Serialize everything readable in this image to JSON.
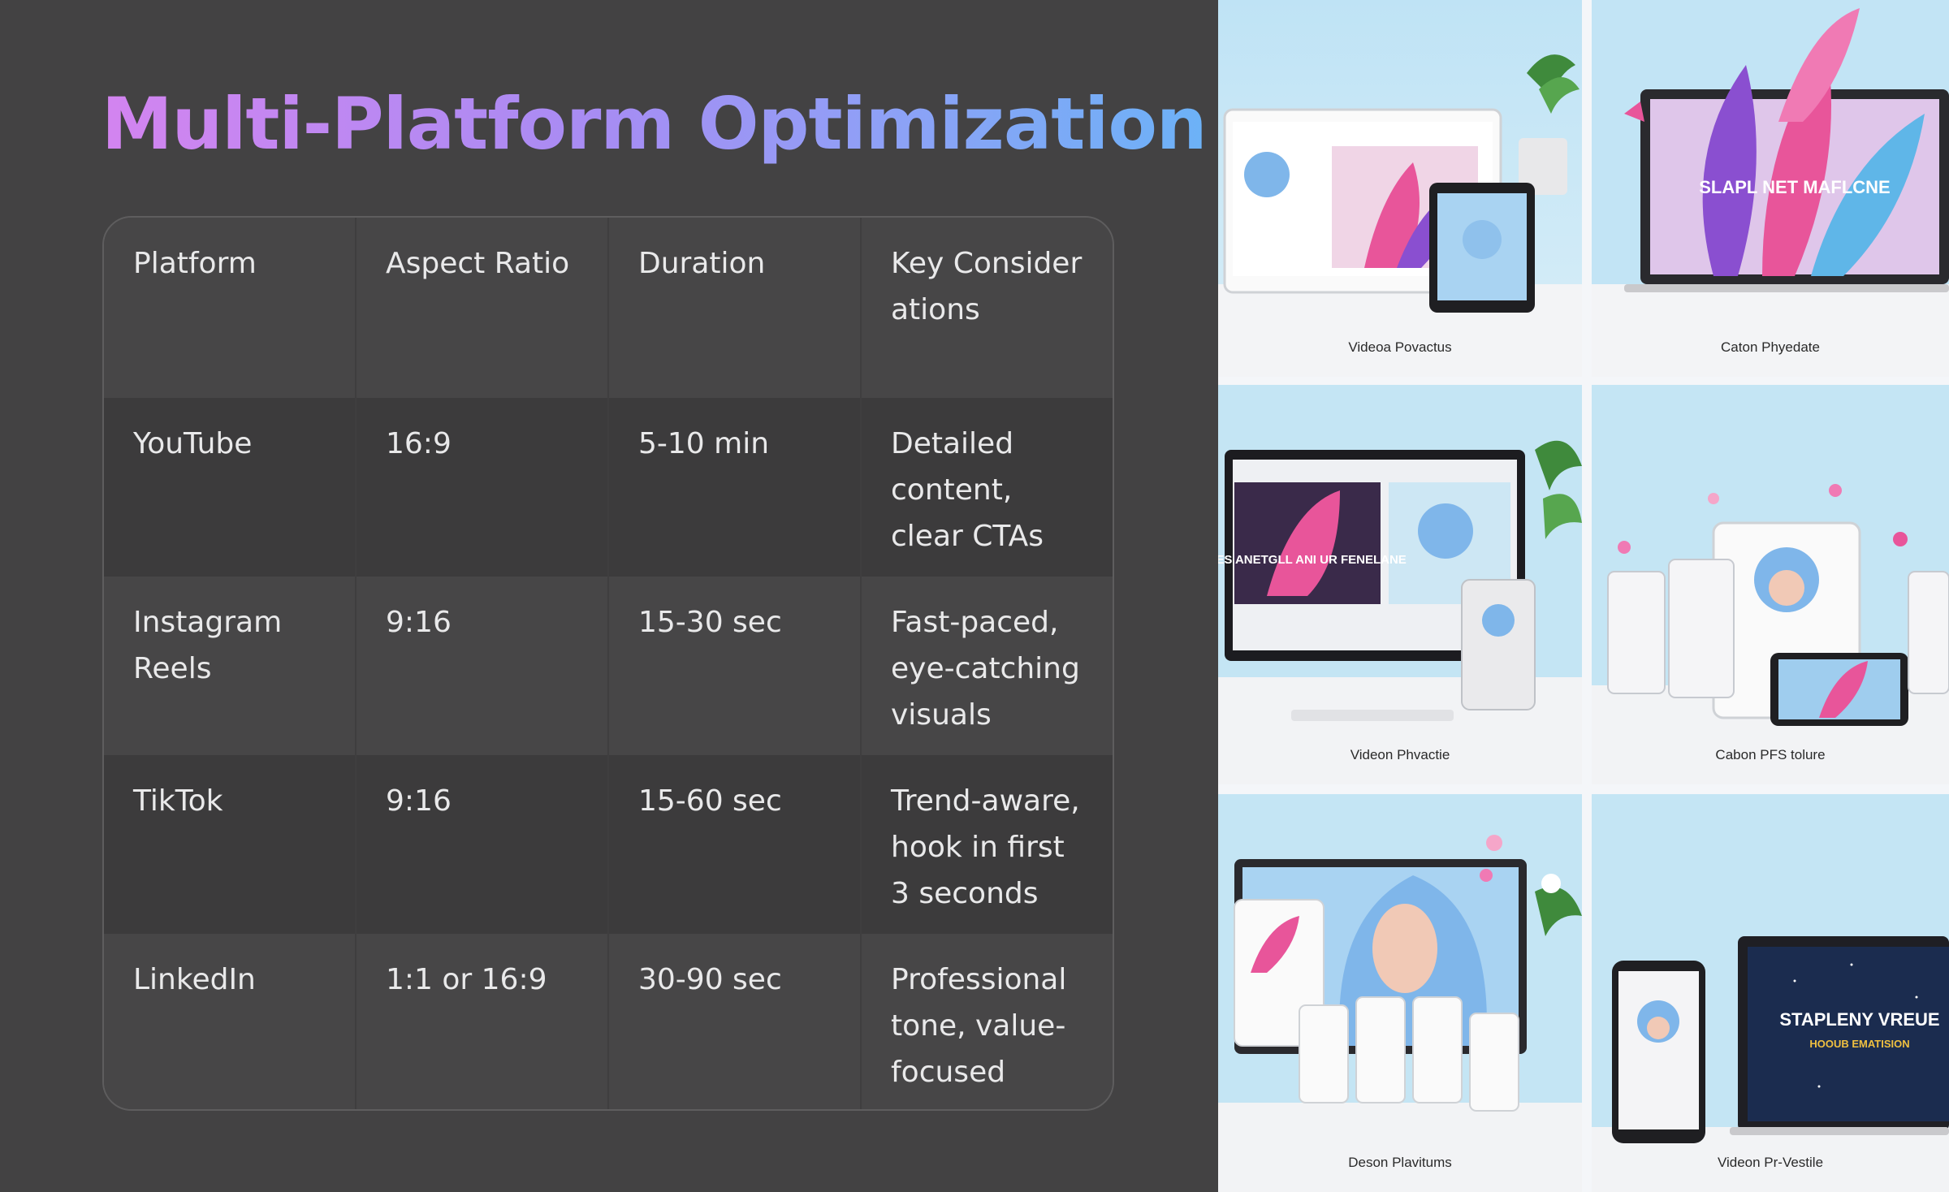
{
  "title": "Multi-Platform Optimization",
  "table": {
    "headers": [
      "Platform",
      "Aspect Ratio",
      "Duration",
      "Key Considerations"
    ],
    "rows": [
      [
        "YouTube",
        "16:9",
        "5-10 min",
        "Detailed content, clear CTAs"
      ],
      [
        "Instagram Reels",
        "9:16",
        "15-30 sec",
        "Fast-paced, eye-catching visuals"
      ],
      [
        "TikTok",
        "9:16",
        "15-60 sec",
        "Trend-aware, hook in first 3 seconds"
      ],
      [
        "LinkedIn",
        "1:1 or 16:9",
        "30-90 sec",
        "Professional tone, value-focused"
      ]
    ]
  },
  "gallery": {
    "captions": [
      "Videoa Povactus",
      "Caton Phyedate",
      "Videon Phvactie",
      "Cabon PFS tolure",
      "Deson Plavitums",
      "Videon Pr-Vestile"
    ],
    "overlay_texts": [
      "SLAPL NET MAFLCNE",
      "LES ANETGLL ANI UR FENELANE",
      "STAPLENY VREUE",
      "HOOUB EMATISION"
    ],
    "colors": {
      "sky": "#bfe3f5",
      "feather_pink": "#e8559a",
      "feather_purple": "#8a4fd0",
      "hair_blue": "#7fb6ea"
    }
  }
}
